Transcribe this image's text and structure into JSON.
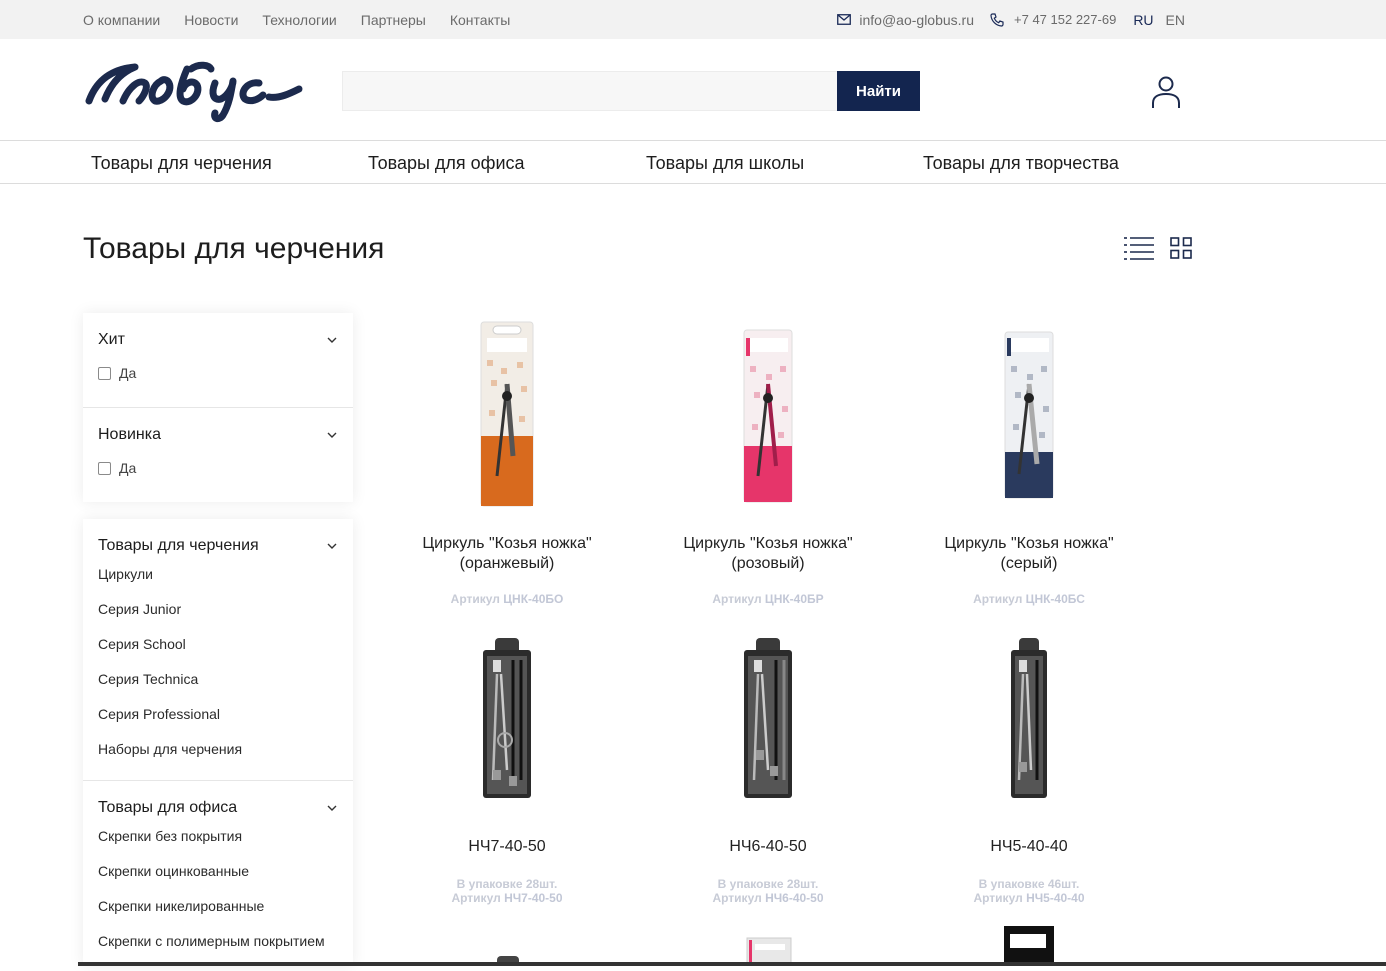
{
  "topbar": {
    "nav": [
      "О компании",
      "Новости",
      "Технологии",
      "Партнеры",
      "Контакты"
    ],
    "email": "info@ao-globus.ru",
    "phone": "+7 47 152 227-69",
    "languages": [
      "RU",
      "EN"
    ],
    "active_language": "RU"
  },
  "header": {
    "logo_text": "глобус",
    "search_placeholder": "",
    "search_button": "Найти"
  },
  "catmenu": [
    "Товары для черчения",
    "Товары для офиса",
    "Товары для школы",
    "Товары для творчества"
  ],
  "page": {
    "title": "Товары для черчения"
  },
  "filters": [
    {
      "title": "Хит",
      "option": "Да"
    },
    {
      "title": "Новинка",
      "option": "Да"
    }
  ],
  "categories": [
    {
      "title": "Товары для черчения",
      "items": [
        "Циркули",
        "Серия Junior",
        "Серия School",
        "Серия Technica",
        "Серия Professional",
        "Наборы для черчения"
      ]
    },
    {
      "title": "Товары для офиса",
      "items": [
        "Скрепки без покрытия",
        "Скрепки оцинкованные",
        "Скрепки никелированные",
        "Скрепки с полимерным покрытием"
      ]
    }
  ],
  "products": [
    {
      "name": "Циркуль \"Козья ножка\" (оранжевый)",
      "package": "",
      "article_label": "Артикул",
      "article": "ЦНК-40БО",
      "color": "#d86a1e"
    },
    {
      "name": "Циркуль \"Козья ножка\" (розовый)",
      "package": "",
      "article_label": "Артикул",
      "article": "ЦНК-40БР",
      "color": "#e6356a"
    },
    {
      "name": "Циркуль \"Козья ножка\" (серый)",
      "package": "",
      "article_label": "Артикул",
      "article": "ЦНК-40БС",
      "color": "#2a3a5e"
    },
    {
      "name": "НЧ7-40-50",
      "package": "В упаковке 28шт.",
      "article_label": "Артикул",
      "article": "НЧ7-40-50",
      "color": "#2b2b2b"
    },
    {
      "name": "НЧ6-40-50",
      "package": "В упаковке 28шт.",
      "article_label": "Артикул",
      "article": "НЧ6-40-50",
      "color": "#2b2b2b"
    },
    {
      "name": "НЧ5-40-40",
      "package": "В упаковке 46шт.",
      "article_label": "Артикул",
      "article": "НЧ5-40-40",
      "color": "#2b2b2b"
    }
  ],
  "colors": {
    "brand": "#13254f",
    "topbar_bg": "#f2f2f2",
    "muted_text": "#6b6b6b"
  }
}
